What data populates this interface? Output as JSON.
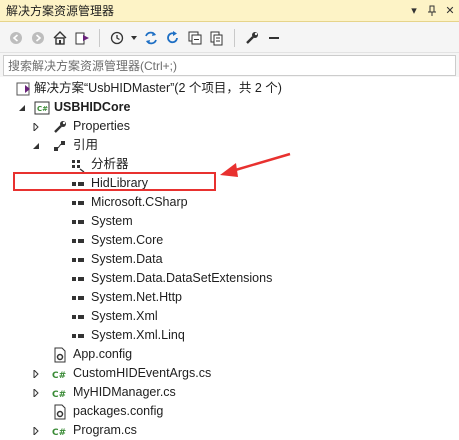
{
  "panel": {
    "title": "解决方案资源管理器",
    "pin_label": "▾",
    "pin_icon": "pin-icon",
    "close_label": "✕"
  },
  "toolbar": {
    "icons": [
      "back-icon",
      "forward-icon",
      "home-icon",
      "switch-views-icon",
      "history-icon",
      "dropdown-icon",
      "sync-icon",
      "refresh-icon",
      "collapse-all-icon",
      "show-all-files-icon",
      "properties-wrench-icon",
      "preview-icon"
    ]
  },
  "search": {
    "placeholder": "搜索解决方案资源管理器(Ctrl+;)"
  },
  "tree": {
    "solution": "解决方案“UsbHIDMaster”(2 个项目，共 2 个)",
    "project": "USBHIDCore",
    "properties": "Properties",
    "references": "引用",
    "analyzers": "分析器",
    "refs": [
      "HidLibrary",
      "Microsoft.CSharp",
      "System",
      "System.Core",
      "System.Data",
      "System.Data.DataSetExtensions",
      "System.Net.Http",
      "System.Xml",
      "System.Xml.Linq"
    ],
    "files": [
      {
        "name": "App.config",
        "icon": "config-file-icon",
        "expandable": false
      },
      {
        "name": "CustomHIDEventArgs.cs",
        "icon": "csharp-file-icon",
        "expandable": true
      },
      {
        "name": "MyHIDManager.cs",
        "icon": "csharp-file-icon",
        "expandable": true
      },
      {
        "name": "packages.config",
        "icon": "config-file-icon",
        "expandable": false
      },
      {
        "name": "Program.cs",
        "icon": "csharp-file-icon",
        "expandable": true
      }
    ]
  },
  "colors": {
    "title_bg": "#fdf3c6",
    "highlight": "#e8312f",
    "csharp_green": "#388a34",
    "vs_purple": "#68217a"
  }
}
